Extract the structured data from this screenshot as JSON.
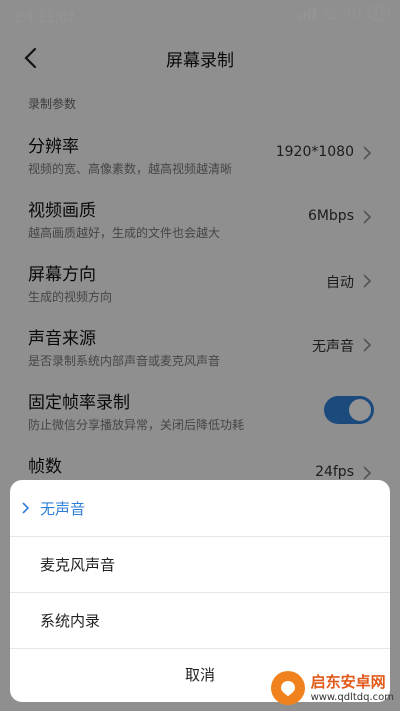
{
  "status": {
    "time": "上午11:07",
    "network": "4G",
    "battery": "81"
  },
  "page": {
    "title": "屏幕录制"
  },
  "section": {
    "label": "录制参数"
  },
  "rows": [
    {
      "title": "分辨率",
      "subtitle": "视频的宽、高像素数，越高视频越清晰",
      "value": "1920*1080"
    },
    {
      "title": "视频画质",
      "subtitle": "越高画质越好，生成的文件也会越大",
      "value": "6Mbps"
    },
    {
      "title": "屏幕方向",
      "subtitle": "生成的视频方向",
      "value": "自动"
    },
    {
      "title": "声音来源",
      "subtitle": "是否录制系统内部声音或麦克风声音",
      "value": "无声音"
    },
    {
      "title": "固定帧率录制",
      "subtitle": "防止微信分享播放异常，关闭后降低功耗",
      "toggle_on": true
    },
    {
      "title": "帧数",
      "value": "24fps"
    }
  ],
  "sheet": {
    "options": [
      {
        "label": "无声音",
        "selected": true
      },
      {
        "label": "麦克风声音",
        "selected": false
      },
      {
        "label": "系统内录",
        "selected": false
      }
    ],
    "cancel": "取消"
  },
  "watermark": {
    "name": "启东安卓网",
    "url": "www.qdltdq.com"
  },
  "colors": {
    "accent": "#2f80d8",
    "watermark": "#f0821e"
  }
}
